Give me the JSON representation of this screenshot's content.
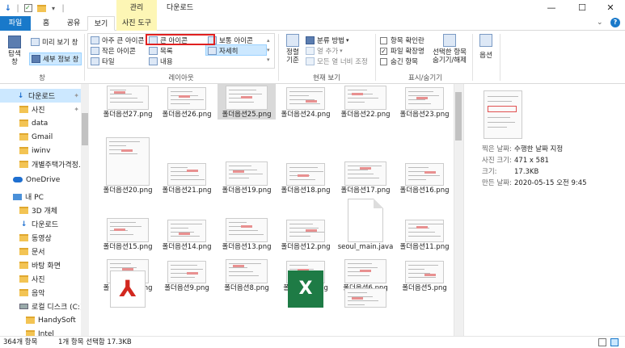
{
  "titlebar": {
    "manage_tab": "관리",
    "title": "다운로드",
    "minimize": "—",
    "maximize": "☐",
    "close": "✕"
  },
  "tabs": {
    "file": "파일",
    "home": "홈",
    "share": "공유",
    "view": "보기",
    "photo_tools": "사진 도구"
  },
  "ribbon": {
    "pane": {
      "nav_pane": "탐색\n창",
      "preview_pane": "미리 보기 창",
      "details_pane": "세부 정보 창",
      "label": "창"
    },
    "layout": {
      "extra_large": "아주 큰 아이콘",
      "large": "큰 아이콘",
      "medium": "보통 아이콘",
      "small": "작은 아이콘",
      "list": "목록",
      "details": "자세히",
      "tiles": "타일",
      "content": "내용",
      "label": "레이아웃"
    },
    "current_view": {
      "sort": "정렬\n기준",
      "group_by": "분류 방법",
      "add_columns": "열 추가",
      "size_all_columns": "모든 열 너비 조정",
      "label": "현재 보기"
    },
    "show_hide": {
      "item_checkboxes": "항목 확인란",
      "file_extensions": "파일 확장명",
      "hidden_items": "숨긴 항목",
      "hide_selected": "선택한 항목\n숨기기/해제",
      "label": "표시/숨기기"
    },
    "options": "옵션"
  },
  "nav": {
    "items": [
      {
        "label": "다운로드",
        "type": "download",
        "pinned": true
      },
      {
        "label": "사진",
        "type": "folder",
        "pinned": true
      },
      {
        "label": "data",
        "type": "folder"
      },
      {
        "label": "Gmail",
        "type": "folder"
      },
      {
        "label": "iwinv",
        "type": "folder"
      },
      {
        "label": "개별주택가격정.",
        "type": "folder"
      },
      {
        "label": "OneDrive",
        "type": "cloud"
      },
      {
        "label": "내 PC",
        "type": "pc"
      },
      {
        "label": "3D 개체",
        "type": "folder"
      },
      {
        "label": "다운로드",
        "type": "download"
      },
      {
        "label": "동영상",
        "type": "folder"
      },
      {
        "label": "문서",
        "type": "folder"
      },
      {
        "label": "바탕 화면",
        "type": "folder"
      },
      {
        "label": "사진",
        "type": "folder"
      },
      {
        "label": "음악",
        "type": "folder"
      },
      {
        "label": "로컬 디스크 (C:)",
        "type": "drive"
      },
      {
        "label": "HandySoft",
        "type": "folder"
      },
      {
        "label": "Intel",
        "type": "folder"
      }
    ]
  },
  "files": [
    {
      "name": "폴더옵션27.png",
      "kind": "img"
    },
    {
      "name": "폴더옵션26.png",
      "kind": "img"
    },
    {
      "name": "폴더옵션25.png",
      "kind": "img",
      "selected": true
    },
    {
      "name": "폴더옵션24.png",
      "kind": "img"
    },
    {
      "name": "폴더옵션22.png",
      "kind": "img"
    },
    {
      "name": "폴더옵션23.png",
      "kind": "img"
    },
    {
      "name": "폴더옵션20.png",
      "kind": "img"
    },
    {
      "name": "폴더옵션21.png",
      "kind": "img"
    },
    {
      "name": "폴더옵션19.png",
      "kind": "img"
    },
    {
      "name": "폴더옵션18.png",
      "kind": "img"
    },
    {
      "name": "폴더옵션17.png",
      "kind": "img"
    },
    {
      "name": "폴더옵션16.png",
      "kind": "img"
    },
    {
      "name": "폴더옵션15.png",
      "kind": "img"
    },
    {
      "name": "폴더옵션14.png",
      "kind": "img"
    },
    {
      "name": "폴더옵션13.png",
      "kind": "img"
    },
    {
      "name": "폴더옵션12.png",
      "kind": "img"
    },
    {
      "name": "seoul_main.java",
      "kind": "doc"
    },
    {
      "name": "폴더옵션11.png",
      "kind": "img"
    },
    {
      "name": "폴더옵션10.png",
      "kind": "img"
    },
    {
      "name": "폴더옵션9.png",
      "kind": "img"
    },
    {
      "name": "폴더옵션8.png",
      "kind": "img"
    },
    {
      "name": "폴더옵션7.png",
      "kind": "img"
    },
    {
      "name": "폴더옵션6.png",
      "kind": "img"
    },
    {
      "name": "폴더옵션5.png",
      "kind": "img"
    },
    {
      "name": "",
      "kind": "pdf"
    },
    {
      "name": "",
      "kind": "none"
    },
    {
      "name": "",
      "kind": "none"
    },
    {
      "name": "",
      "kind": "xls"
    },
    {
      "name": "",
      "kind": "img"
    },
    {
      "name": "",
      "kind": "none"
    }
  ],
  "details": {
    "rows": [
      {
        "key": "찍은 날짜:",
        "value": "수행한 날짜 지정"
      },
      {
        "key": "사진 크기:",
        "value": "471 x 581"
      },
      {
        "key": "크기:",
        "value": "17.3KB"
      },
      {
        "key": "만든 날짜:",
        "value": "2020-05-15 오전 9:45"
      }
    ]
  },
  "status": {
    "count": "364개 항목",
    "selection": "1개 항목 선택함 17.3KB"
  },
  "colors": {
    "accent": "#1979ca",
    "selection": "#cce8ff",
    "photo_tools": "#fdf6b5",
    "highlight": "#e02020"
  }
}
